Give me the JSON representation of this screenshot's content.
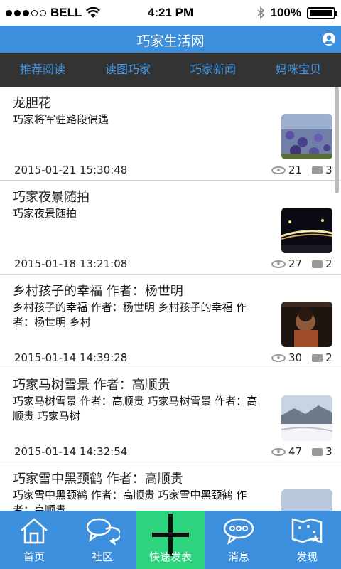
{
  "status_bar": {
    "carrier": "BELL",
    "time": "4:21 PM",
    "battery": "100%"
  },
  "header": {
    "title": "巧家生活网"
  },
  "tabs": [
    {
      "label": "推荐阅读"
    },
    {
      "label": "读图巧家"
    },
    {
      "label": "巧家新闻"
    },
    {
      "label": "妈咪宝贝"
    }
  ],
  "articles": [
    {
      "title": "龙胆花",
      "summary": "巧家将军驻路段偶遇",
      "date": "2015-01-21 15:30:48",
      "views": "21",
      "comments": "3"
    },
    {
      "title": "巧家夜景随拍",
      "summary": "巧家夜景随拍",
      "date": "2015-01-18 13:21:08",
      "views": "27",
      "comments": "2"
    },
    {
      "title": "乡村孩子的幸福 作者：杨世明",
      "summary": "乡村孩子的幸福 作者：杨世明 乡村孩子的幸福 作者：杨世明 乡村",
      "date": "2015-01-14 14:39:28",
      "views": "30",
      "comments": "2"
    },
    {
      "title": "巧家马树雪景 作者：高顺贵",
      "summary": "巧家马树雪景 作者：高顺贵 巧家马树雪景 作者：高顺贵 巧家马树",
      "date": "2015-01-14 14:32:54",
      "views": "47",
      "comments": "3"
    },
    {
      "title": "巧家雪中黑颈鹤 作者：高顺贵",
      "summary": "巧家雪中黑颈鹤 作者：高顺贵 巧家雪中黑颈鹤 作者：高顺贵",
      "date": "",
      "views": "",
      "comments": ""
    }
  ],
  "bottom_nav": [
    {
      "label": "首页",
      "icon": "home-icon"
    },
    {
      "label": "社区",
      "icon": "chat-bubbles-icon"
    },
    {
      "label": "快速发表",
      "icon": "plus-icon"
    },
    {
      "label": "消息",
      "icon": "message-icon"
    },
    {
      "label": "发现",
      "icon": "discover-icon"
    }
  ],
  "colors": {
    "header_blue": "#3c8fdc",
    "tab_bar": "#333333",
    "tab_text": "#3e97e6",
    "active_nav": "#2fd47f"
  }
}
